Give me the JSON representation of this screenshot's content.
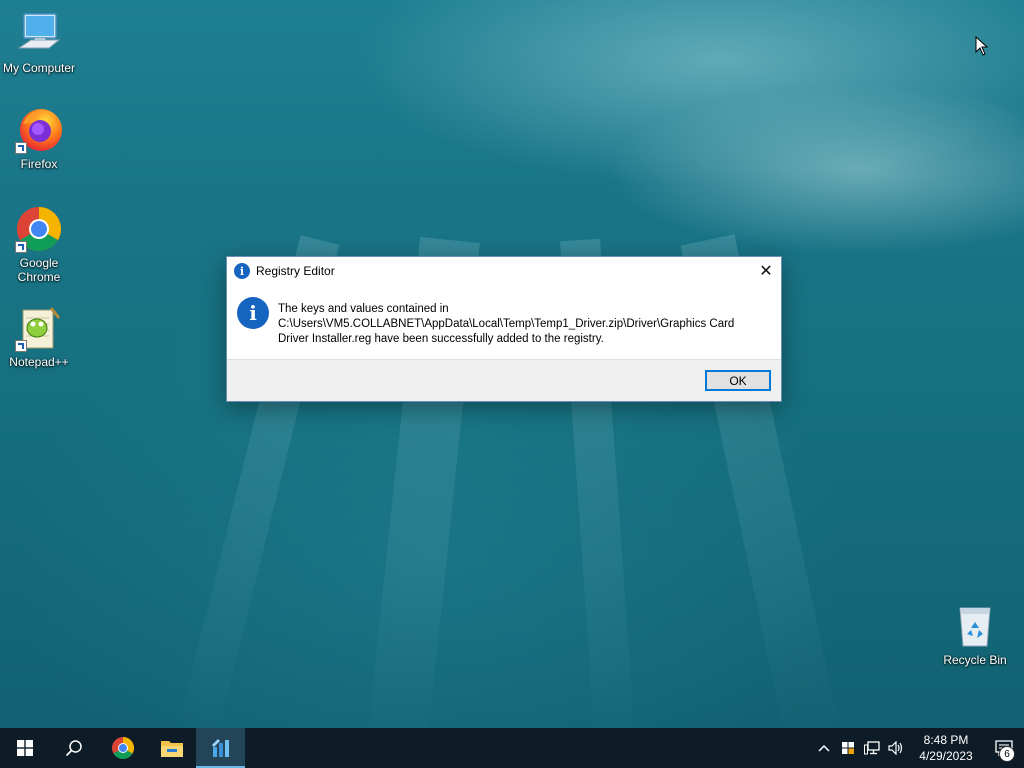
{
  "desktop": {
    "icons": [
      {
        "label": "My Computer",
        "icon": "computer-icon"
      },
      {
        "label": "Firefox",
        "icon": "firefox-icon"
      },
      {
        "label": "Google Chrome",
        "icon": "chrome-icon"
      },
      {
        "label": "Notepad++",
        "icon": "notepadpp-icon"
      },
      {
        "label": "Recycle Bin",
        "icon": "recycle-bin-icon"
      }
    ]
  },
  "dialog": {
    "title": "Registry Editor",
    "message_line1": "The keys and values contained in",
    "message_line2": "C:\\Users\\VM5.COLLABNET\\AppData\\Local\\Temp\\Temp1_Driver.zip\\Driver\\Graphics Card",
    "message_line3": "Driver Installer.reg have been successfully added to the registry.",
    "ok_label": "OK",
    "close_label": "✕"
  },
  "taskbar": {
    "pinned": [
      "start-icon",
      "search-icon",
      "chrome-icon",
      "file-explorer-icon",
      "registry-editor-icon"
    ],
    "tray": {
      "time": "8:48 PM",
      "date": "4/29/2023",
      "notification_count": "6"
    }
  },
  "colors": {
    "accent": "#0078d7",
    "info_blue": "#1565c0",
    "taskbar": "#0d1c26"
  }
}
